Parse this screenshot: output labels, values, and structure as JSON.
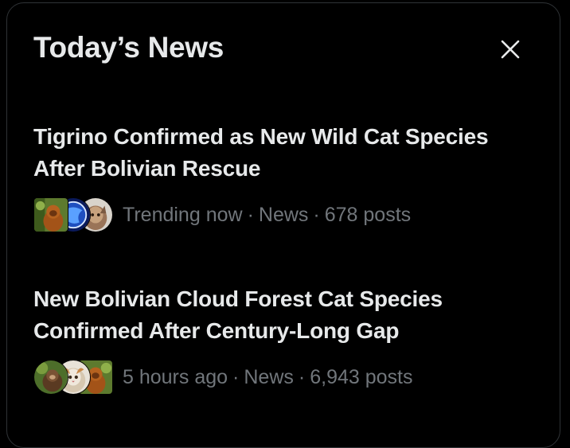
{
  "panel": {
    "title": "Today’s News",
    "close_label": "Close"
  },
  "stories": [
    {
      "headline": "Tigrino Confirmed as New Wild Cat Species After Bolivian Rescue",
      "time": "Trending now",
      "category": "News",
      "posts": "678 posts",
      "separator": "·",
      "avatars": [
        "orangutan-photo",
        "globe-logo",
        "cat-photo"
      ]
    },
    {
      "headline": "New Bolivian Cloud Forest Cat Species Confirmed After Century-Long Gap",
      "time": "5 hours ago",
      "category": "News",
      "posts": "6,943 posts",
      "separator": "·",
      "avatars": [
        "monkey-photo",
        "cat-photo",
        "orangutan-photo"
      ]
    }
  ],
  "colors": {
    "background": "#000000",
    "text_primary": "#e7e9ea",
    "text_secondary": "#71767b",
    "border": "#2f3336"
  }
}
